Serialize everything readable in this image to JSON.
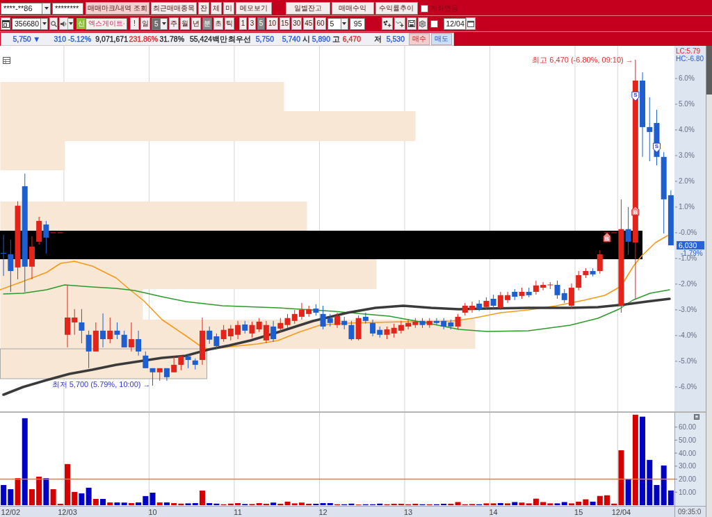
{
  "account_bar": {
    "account_field": {
      "value": "****-**86"
    },
    "password_field": {
      "value": "********"
    },
    "buttons": [
      {
        "label": "매매마크/내역 조회",
        "kind": "highlight"
      },
      {
        "label": "최근매매종목",
        "kind": "plain"
      },
      {
        "label": "잔",
        "kind": "plain"
      },
      {
        "label": "체",
        "kind": "plain"
      },
      {
        "label": "미",
        "kind": "plain"
      },
      {
        "label": "메모보기",
        "kind": "plain"
      }
    ],
    "report_buttons": [
      {
        "label": "일별잔고"
      },
      {
        "label": "매매수익"
      },
      {
        "label": "수익률추이"
      }
    ],
    "account_link": {
      "label": "계좌연동",
      "checked": false
    }
  },
  "symbol_bar": {
    "code_field": {
      "value": "356680"
    },
    "market_badge": "신",
    "name_field": {
      "value": "엑스게이트"
    },
    "alert_button": "!",
    "periods": [
      {
        "label": "일",
        "selected": false
      },
      {
        "label": "주",
        "selected": false
      },
      {
        "label": "월",
        "selected": false
      },
      {
        "label": "년",
        "selected": false
      },
      {
        "label": "분",
        "selected": true
      },
      {
        "label": "초",
        "selected": false
      },
      {
        "label": "틱",
        "selected": false
      }
    ],
    "day_count": {
      "value": "5",
      "highlighted": true
    },
    "intervals": [
      {
        "label": "1",
        "selected": false
      },
      {
        "label": "3",
        "selected": false
      },
      {
        "label": "5",
        "selected": true
      },
      {
        "label": "10",
        "selected": false
      },
      {
        "label": "15",
        "selected": false
      },
      {
        "label": "30",
        "selected": false
      },
      {
        "label": "45",
        "selected": false
      },
      {
        "label": "60",
        "selected": false
      }
    ],
    "interval_field": {
      "value": "5"
    },
    "bar_count_field": {
      "value": "95"
    },
    "sync": {
      "checked": false
    },
    "date_field": {
      "value": "12/04"
    }
  },
  "quote": {
    "items": [
      {
        "text": "5,750 ▼",
        "color": "#2558d6"
      },
      {
        "text": "310",
        "color": "#2558d6"
      },
      {
        "text": "-5.12%",
        "color": "#2558d6"
      },
      {
        "text": "9,071,671"
      },
      {
        "text": "231.86%",
        "color": "#e0262b"
      },
      {
        "text": "31.78%"
      },
      {
        "text": "55,424백만"
      },
      {
        "text": "최우선"
      },
      {
        "text": "5,750",
        "color": "#2558d6"
      },
      {
        "text": "5,740",
        "color": "#2558d6"
      },
      {
        "text": "시"
      },
      {
        "text": "5,890",
        "color": "#2558d6"
      },
      {
        "text": "고"
      },
      {
        "text": "6,470",
        "color": "#e0262b"
      },
      {
        "text": "저"
      },
      {
        "text": "5,530",
        "color": "#2558d6"
      }
    ],
    "order_buttons": [
      {
        "label": "매수",
        "kind": "buy"
      },
      {
        "label": "매도",
        "kind": "sell"
      }
    ]
  },
  "price_chart": {
    "limit_labels": [
      {
        "text": "LC:5.79",
        "color": "#e0262b"
      },
      {
        "text": "HC:-6.80",
        "color": "#2558d6"
      }
    ],
    "axis_labels": [
      "6.0%",
      "5.0%",
      "4.0%",
      "3.0%",
      "2.0%",
      "1.0%",
      "-0.0%",
      "-1.0%",
      "-2.0%",
      "-3.0%",
      "-4.0%",
      "-5.0%",
      "-6.0%"
    ],
    "current_price": {
      "value": "6,030",
      "change": "-1.79%"
    },
    "extreme_labels": [
      {
        "text": "최고 6,470 (-6.80%, 09:10) →",
        "color": "#e03232"
      },
      {
        "text": "최저 5,700 (5.79%, 10:00) →",
        "color": "#3434c8"
      }
    ],
    "trade_marks": [
      {
        "text": "B",
        "kind": "buy"
      },
      {
        "text": "B",
        "kind": "buy"
      },
      {
        "text": "S",
        "kind": "sell"
      },
      {
        "text": "S",
        "kind": "sell"
      }
    ]
  },
  "volume_chart": {
    "time_readout": "09:35:0",
    "chart_data": {
      "type": "bar",
      "stacked": true,
      "categories": [
        null,
        "12/02",
        null,
        null,
        null,
        null,
        null,
        null,
        null,
        "12/03",
        null,
        null,
        null,
        null,
        null,
        null,
        null,
        null,
        null,
        null,
        null,
        "10",
        null,
        null,
        null,
        null,
        null,
        null,
        null,
        null,
        null,
        null,
        null,
        "11",
        null,
        null,
        null,
        null,
        null,
        null,
        null,
        null,
        null,
        null,
        null,
        "12",
        null,
        null,
        null,
        null,
        null,
        null,
        null,
        null,
        null,
        null,
        null,
        "13",
        null,
        null,
        null,
        null,
        null,
        null,
        null,
        null,
        null,
        null,
        null,
        "14",
        null,
        null,
        null,
        null,
        null,
        null,
        null,
        null,
        null,
        null,
        null,
        "15",
        null,
        null,
        null,
        null,
        null,
        "12/04",
        null,
        null,
        null,
        null,
        null,
        null,
        null
      ],
      "ylim": [
        0,
        71
      ],
      "yticks": [
        {
          "value": 60,
          "label": "60.00"
        },
        {
          "value": 50,
          "label": "50.00"
        },
        {
          "value": 40,
          "label": "40.00"
        },
        {
          "value": 30,
          "label": "30.00"
        },
        {
          "value": 20,
          "label": "20.00"
        },
        {
          "value": 10,
          "label": "10.00"
        }
      ],
      "series": [
        {
          "color": "#d40000",
          "values": [
            0,
            0,
            20.8,
            0,
            12.3,
            21.9,
            0,
            12.3,
            1.1,
            31.6,
            10.2,
            0,
            0,
            4.8,
            0,
            2.1,
            0,
            0,
            1.6,
            0,
            0,
            0,
            2.1,
            0,
            1.6,
            1.2,
            0,
            0,
            11.2,
            0,
            0,
            0.7,
            1.2,
            1.6,
            0,
            0.9,
            1.6,
            1.1,
            0,
            1.1,
            2.7,
            1.4,
            2.0,
            1.1,
            0,
            0,
            0,
            0.7,
            0,
            0,
            0.5,
            0,
            0,
            0,
            0.7,
            1.1,
            1.1,
            0.7,
            1.1,
            0,
            0.7,
            0,
            0,
            1.1,
            2.4,
            0.7,
            0.9,
            0,
            1.4,
            1.4,
            0,
            1.4,
            0,
            2.0,
            1.4,
            5.0,
            2.4,
            1.4,
            0,
            0,
            1.4,
            2.7,
            4.5,
            0,
            7.1,
            7.6,
            1.2,
            42.2,
            0,
            69.5,
            0,
            0,
            0,
            0,
            0
          ]
        },
        {
          "color": "#0000c4",
          "values": [
            15.5,
            12.3,
            0,
            66.8,
            0,
            0,
            20.8,
            0,
            0,
            0,
            0,
            9.1,
            13.4,
            0,
            4.8,
            0,
            2.1,
            2.0,
            0,
            2.1,
            7.0,
            9.6,
            0,
            2.1,
            0,
            0,
            1.4,
            1.6,
            0,
            1.6,
            1.2,
            0,
            0,
            0,
            0.9,
            0,
            0,
            0,
            2.0,
            0,
            0,
            0,
            0,
            0,
            1.1,
            1.6,
            1.6,
            0,
            0.7,
            1.2,
            0,
            0.7,
            0.7,
            1.2,
            0,
            0,
            0,
            0,
            0,
            0.7,
            0,
            0.7,
            1.1,
            0,
            0,
            0,
            0,
            0.7,
            0,
            0,
            1.6,
            0,
            2.4,
            0,
            0,
            0,
            0,
            0,
            1.4,
            2.4,
            0,
            0,
            0,
            2.7,
            0,
            0,
            0,
            0,
            19.8,
            0,
            68.0,
            34.8,
            15.5,
            30.5,
            11.3
          ]
        }
      ],
      "ref_lines": [
        {
          "axis": "y",
          "value": 20
        }
      ]
    }
  }
}
